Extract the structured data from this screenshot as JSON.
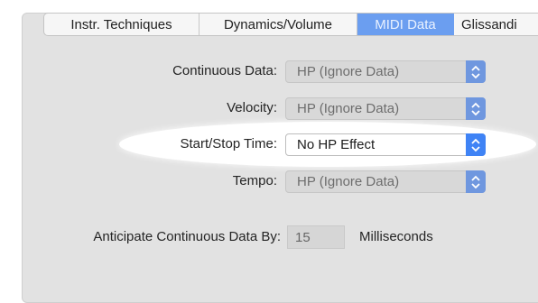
{
  "tabs": [
    {
      "label": "Instr. Techniques",
      "selected": false
    },
    {
      "label": "Dynamics/Volume",
      "selected": false
    },
    {
      "label": "MIDI Data",
      "selected": true
    },
    {
      "label": "Glissandi",
      "selected": false
    }
  ],
  "settings": {
    "continuous_data": {
      "label": "Continuous Data:",
      "value": "HP (Ignore Data)"
    },
    "velocity": {
      "label": "Velocity:",
      "value": "HP (Ignore Data)"
    },
    "start_stop_time": {
      "label": "Start/Stop Time:",
      "value": "No HP Effect"
    },
    "tempo": {
      "label": "Tempo:",
      "value": "HP (Ignore Data)"
    }
  },
  "anticipate": {
    "label": "Anticipate Continuous Data By:",
    "value": "15",
    "unit": "Milliseconds"
  },
  "colors": {
    "selected_tab": "#6b9ef0",
    "stepper_active": "#3f83f5",
    "stepper_inactive": "#6f97df"
  }
}
